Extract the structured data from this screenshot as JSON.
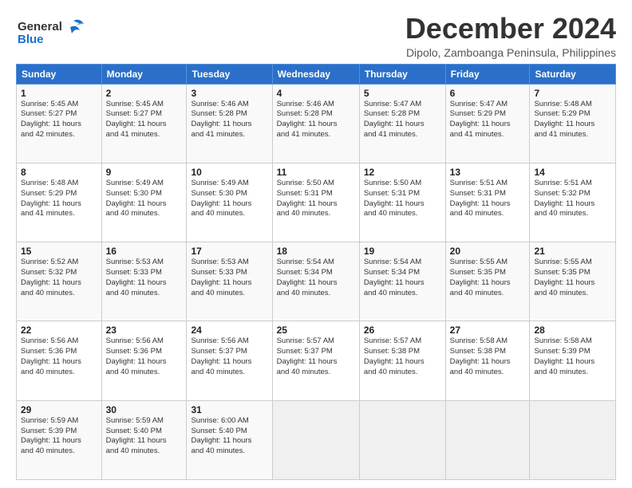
{
  "logo": {
    "line1": "General",
    "line2": "Blue"
  },
  "title": "December 2024",
  "subtitle": "Dipolo, Zamboanga Peninsula, Philippines",
  "header_days": [
    "Sunday",
    "Monday",
    "Tuesday",
    "Wednesday",
    "Thursday",
    "Friday",
    "Saturday"
  ],
  "weeks": [
    [
      {
        "day": "1",
        "info": "Sunrise: 5:45 AM\nSunset: 5:27 PM\nDaylight: 11 hours\nand 42 minutes."
      },
      {
        "day": "2",
        "info": "Sunrise: 5:45 AM\nSunset: 5:27 PM\nDaylight: 11 hours\nand 41 minutes."
      },
      {
        "day": "3",
        "info": "Sunrise: 5:46 AM\nSunset: 5:28 PM\nDaylight: 11 hours\nand 41 minutes."
      },
      {
        "day": "4",
        "info": "Sunrise: 5:46 AM\nSunset: 5:28 PM\nDaylight: 11 hours\nand 41 minutes."
      },
      {
        "day": "5",
        "info": "Sunrise: 5:47 AM\nSunset: 5:28 PM\nDaylight: 11 hours\nand 41 minutes."
      },
      {
        "day": "6",
        "info": "Sunrise: 5:47 AM\nSunset: 5:29 PM\nDaylight: 11 hours\nand 41 minutes."
      },
      {
        "day": "7",
        "info": "Sunrise: 5:48 AM\nSunset: 5:29 PM\nDaylight: 11 hours\nand 41 minutes."
      }
    ],
    [
      {
        "day": "8",
        "info": "Sunrise: 5:48 AM\nSunset: 5:29 PM\nDaylight: 11 hours\nand 41 minutes."
      },
      {
        "day": "9",
        "info": "Sunrise: 5:49 AM\nSunset: 5:30 PM\nDaylight: 11 hours\nand 40 minutes."
      },
      {
        "day": "10",
        "info": "Sunrise: 5:49 AM\nSunset: 5:30 PM\nDaylight: 11 hours\nand 40 minutes."
      },
      {
        "day": "11",
        "info": "Sunrise: 5:50 AM\nSunset: 5:31 PM\nDaylight: 11 hours\nand 40 minutes."
      },
      {
        "day": "12",
        "info": "Sunrise: 5:50 AM\nSunset: 5:31 PM\nDaylight: 11 hours\nand 40 minutes."
      },
      {
        "day": "13",
        "info": "Sunrise: 5:51 AM\nSunset: 5:31 PM\nDaylight: 11 hours\nand 40 minutes."
      },
      {
        "day": "14",
        "info": "Sunrise: 5:51 AM\nSunset: 5:32 PM\nDaylight: 11 hours\nand 40 minutes."
      }
    ],
    [
      {
        "day": "15",
        "info": "Sunrise: 5:52 AM\nSunset: 5:32 PM\nDaylight: 11 hours\nand 40 minutes."
      },
      {
        "day": "16",
        "info": "Sunrise: 5:53 AM\nSunset: 5:33 PM\nDaylight: 11 hours\nand 40 minutes."
      },
      {
        "day": "17",
        "info": "Sunrise: 5:53 AM\nSunset: 5:33 PM\nDaylight: 11 hours\nand 40 minutes."
      },
      {
        "day": "18",
        "info": "Sunrise: 5:54 AM\nSunset: 5:34 PM\nDaylight: 11 hours\nand 40 minutes."
      },
      {
        "day": "19",
        "info": "Sunrise: 5:54 AM\nSunset: 5:34 PM\nDaylight: 11 hours\nand 40 minutes."
      },
      {
        "day": "20",
        "info": "Sunrise: 5:55 AM\nSunset: 5:35 PM\nDaylight: 11 hours\nand 40 minutes."
      },
      {
        "day": "21",
        "info": "Sunrise: 5:55 AM\nSunset: 5:35 PM\nDaylight: 11 hours\nand 40 minutes."
      }
    ],
    [
      {
        "day": "22",
        "info": "Sunrise: 5:56 AM\nSunset: 5:36 PM\nDaylight: 11 hours\nand 40 minutes."
      },
      {
        "day": "23",
        "info": "Sunrise: 5:56 AM\nSunset: 5:36 PM\nDaylight: 11 hours\nand 40 minutes."
      },
      {
        "day": "24",
        "info": "Sunrise: 5:56 AM\nSunset: 5:37 PM\nDaylight: 11 hours\nand 40 minutes."
      },
      {
        "day": "25",
        "info": "Sunrise: 5:57 AM\nSunset: 5:37 PM\nDaylight: 11 hours\nand 40 minutes."
      },
      {
        "day": "26",
        "info": "Sunrise: 5:57 AM\nSunset: 5:38 PM\nDaylight: 11 hours\nand 40 minutes."
      },
      {
        "day": "27",
        "info": "Sunrise: 5:58 AM\nSunset: 5:38 PM\nDaylight: 11 hours\nand 40 minutes."
      },
      {
        "day": "28",
        "info": "Sunrise: 5:58 AM\nSunset: 5:39 PM\nDaylight: 11 hours\nand 40 minutes."
      }
    ],
    [
      {
        "day": "29",
        "info": "Sunrise: 5:59 AM\nSunset: 5:39 PM\nDaylight: 11 hours\nand 40 minutes."
      },
      {
        "day": "30",
        "info": "Sunrise: 5:59 AM\nSunset: 5:40 PM\nDaylight: 11 hours\nand 40 minutes."
      },
      {
        "day": "31",
        "info": "Sunrise: 6:00 AM\nSunset: 5:40 PM\nDaylight: 11 hours\nand 40 minutes."
      },
      {
        "day": "",
        "info": ""
      },
      {
        "day": "",
        "info": ""
      },
      {
        "day": "",
        "info": ""
      },
      {
        "day": "",
        "info": ""
      }
    ]
  ]
}
